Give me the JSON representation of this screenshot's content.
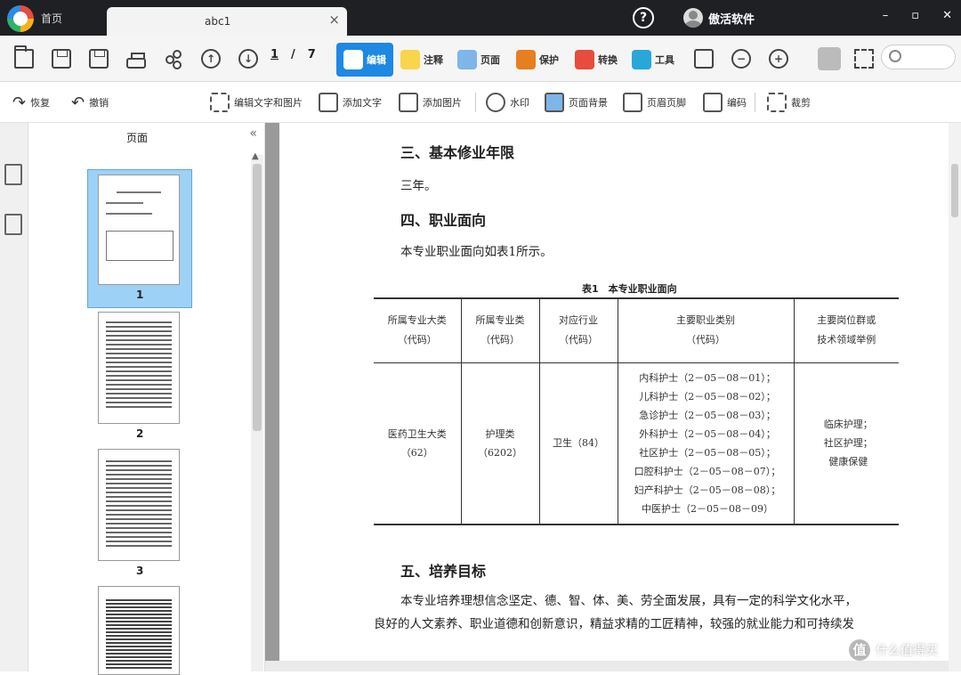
{
  "titlebar": {
    "home_tab": "首页",
    "doc_tab": "abc1",
    "close": "×",
    "help": "?",
    "user_name": "傲活软件"
  },
  "winbtns": {
    "min": "–",
    "max": "▫",
    "close": "✕"
  },
  "pager": {
    "current": "1",
    "sep": "/",
    "total": "7"
  },
  "modes": [
    {
      "label": "编辑"
    },
    {
      "label": "注释"
    },
    {
      "label": "页面"
    },
    {
      "label": "保护"
    },
    {
      "label": "转换"
    },
    {
      "label": "工具"
    }
  ],
  "toolbar2": {
    "restore": "恢复",
    "undo": "撤销",
    "edit_text_image": "编辑文字和图片",
    "add_text": "添加文字",
    "add_image": "添加图片",
    "watermark": "水印",
    "page_bg": "页面背景",
    "header_footer": "页眉页脚",
    "numbering": "编码",
    "crop": "裁剪"
  },
  "pagepanel": {
    "title": "页面",
    "collapse": "«",
    "up": "▲",
    "thumbs": [
      "1",
      "2",
      "3"
    ]
  },
  "doc": {
    "h3": "三、基本修业年限",
    "p3": "三年。",
    "h4": "四、职业面向",
    "p4": "本专业职业面向如表1所示。",
    "caption": "表1　本专业职业面向",
    "table": {
      "headers": [
        "所属专业大类\n（代码）",
        "所属专业类\n（代码）",
        "对应行业\n（代码）",
        "主要职业类别\n（代码）",
        "主要岗位群或\n技术领域举例"
      ],
      "row": [
        "医药卫生大类\n（62）",
        "护理类\n（6202）",
        "卫生（84）",
        "内科护士（2－05－08－01）；\n儿科护士（2－05－08－02）；\n急诊护士（2－05－08－03）；\n外科护士（2－05－08－04）；\n社区护士（2－05－08－05）；\n口腔科护士（2－05－08－07）；\n妇产科护士（2－05－08－08）；\n中医护士（2－05－08－09）",
        "临床护理；\n社区护理；\n健康保健"
      ]
    },
    "h5": "五、培养目标",
    "p5a": "本专业培养理想信念坚定、德、智、体、美、劳全面发展，具有一定的科学文化水平，",
    "p5b": "良好的人文素养、职业道德和创新意识，精益求精的工匠精神，较强的就业能力和可持续发"
  },
  "watermark": {
    "icon": "值",
    "text": "什么值得买"
  }
}
